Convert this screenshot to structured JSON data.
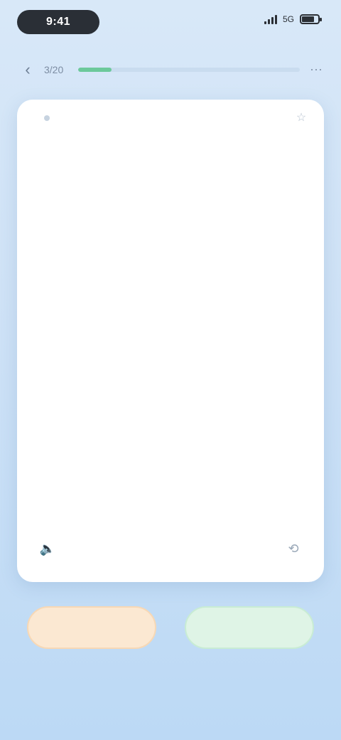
{
  "status_bar": {
    "time": "9:41",
    "network": "5G",
    "battery_level": 0.8
  },
  "progress": {
    "count": "3/20",
    "fraction": 0.15,
    "back_icon": "chevron-left-icon",
    "more_icon": "more-icon"
  },
  "card": {
    "tag": "",
    "word": "",
    "definition": "",
    "corner_icon": "star-icon",
    "left_icon": "speaker-icon",
    "right_icon": "flip-icon"
  },
  "buttons": {
    "unknown_label": "",
    "known_label": ""
  },
  "footer": {
    "hint": ""
  },
  "colors": {
    "accent_blue": "#4a7fc1",
    "progress_green": "#6cc99b",
    "unknown_orange": "#e0904a",
    "known_green": "#5bbf86"
  }
}
